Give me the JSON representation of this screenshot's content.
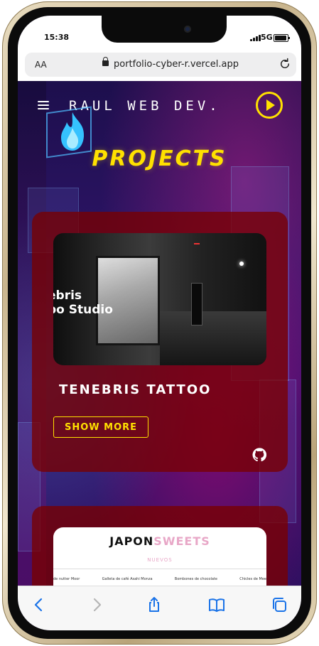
{
  "status": {
    "time": "15:38",
    "network": "5G"
  },
  "browser": {
    "text_size_label": "AA",
    "url": "portfolio-cyber-r.vercel.app"
  },
  "site": {
    "brand": "RAUL WEB DEV.",
    "heading": "PROJECTS",
    "projects": [
      {
        "title": "TENEBRIS TATTOO",
        "preview_text": "ebris\npo Studio",
        "button": "SHOW MORE"
      },
      {
        "preview_logo_dark": "JAPON",
        "preview_logo_light": "SWEETS",
        "preview_section": "NUEVOS",
        "preview_products": [
          "de nutter Moor",
          "Galleta de café Asahi Monza",
          "Bombones de chocolate",
          "Chicles de Mee"
        ]
      }
    ]
  },
  "colors": {
    "accent_yellow": "#ffe100",
    "card_red": "#780000",
    "pink": "#e8a7c7"
  },
  "icons": [
    "menu-icon",
    "play-icon",
    "flame-icon",
    "github-icon",
    "back-icon",
    "forward-icon",
    "share-icon",
    "bookmarks-icon",
    "tabs-icon",
    "lock-icon",
    "reload-icon"
  ]
}
